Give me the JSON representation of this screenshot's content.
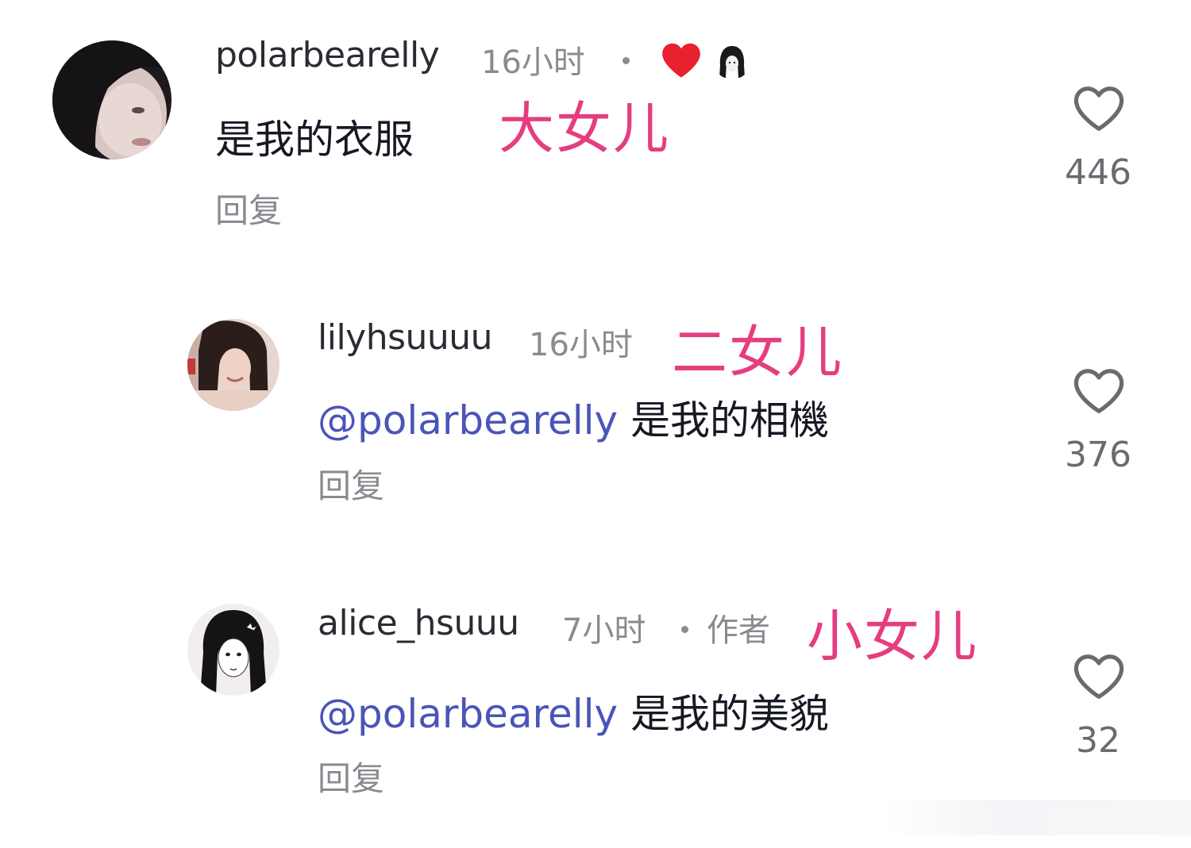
{
  "comments": [
    {
      "username": "polarbearelly",
      "time": "16小时",
      "annotation": "大女儿",
      "text": "是我的衣服",
      "reply_label": "回复",
      "likes": "446",
      "liked_by_author": true
    },
    {
      "username": "lilyhsuuuu",
      "time": "16小时",
      "annotation": "二女儿",
      "mention": "@polarbearelly",
      "text": "是我的相機",
      "reply_label": "回复",
      "likes": "376"
    },
    {
      "username": "alice_hsuuu",
      "time": "7小时",
      "author_tag": "作者",
      "annotation": "小女儿",
      "mention": "@polarbearelly",
      "text": "是我的美貌",
      "reply_label": "回复",
      "likes": "32"
    }
  ],
  "icons": {
    "like": "heart-outline-icon",
    "author_like": "heart-filled-icon"
  },
  "colors": {
    "annotation": "#e53d80",
    "mention": "#4a55b8",
    "liked_heart": "#e8202f",
    "secondary_text": "#8a8b91"
  }
}
